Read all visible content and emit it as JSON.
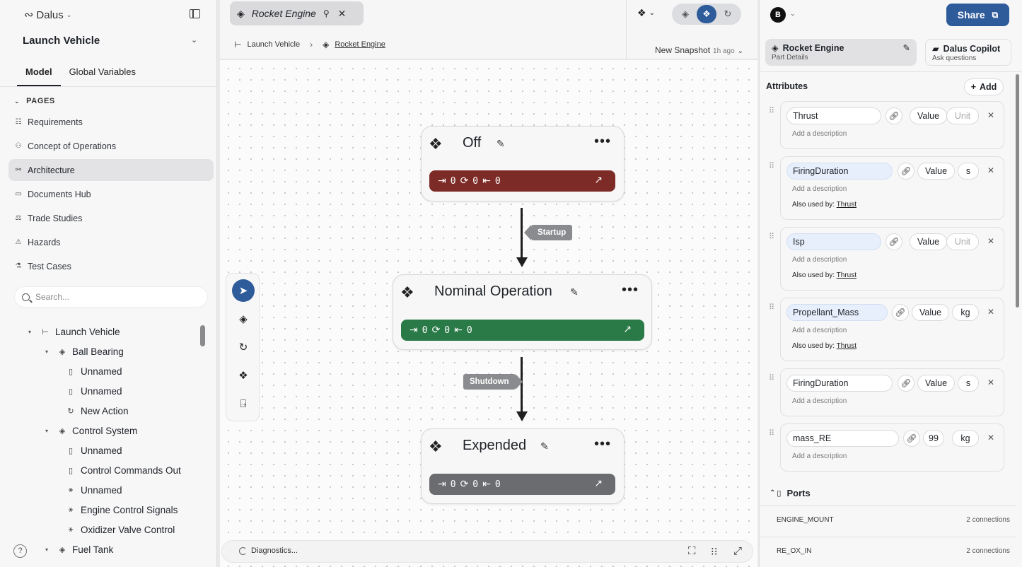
{
  "sidebar": {
    "logo": "Dalus",
    "project": "Launch Vehicle",
    "tabs": [
      "Model",
      "Global Variables"
    ],
    "pages_heading": "PAGES",
    "pages": [
      "Requirements",
      "Concept of Operations",
      "Architecture",
      "Documents Hub",
      "Trade Studies",
      "Hazards",
      "Test Cases"
    ],
    "active_page": "Architecture",
    "search_placeholder": "Search...",
    "tree": [
      {
        "label": "Launch Vehicle",
        "icon": "hierarchy-icon"
      },
      {
        "label": "Ball Bearing",
        "icon": "cube-icon"
      },
      {
        "label": "Unnamed",
        "icon": "port-icon"
      },
      {
        "label": "Unnamed",
        "icon": "port-icon"
      },
      {
        "label": "New Action",
        "icon": "action-icon"
      },
      {
        "label": "Control System",
        "icon": "cube-icon"
      },
      {
        "label": "Unnamed",
        "icon": "port-icon"
      },
      {
        "label": "Control Commands Out",
        "icon": "port-icon"
      },
      {
        "label": "Unnamed",
        "icon": "interface-icon"
      },
      {
        "label": "Engine Control Signals",
        "icon": "interface-icon"
      },
      {
        "label": "Oxidizer Valve Control",
        "icon": "interface-icon"
      },
      {
        "label": "Fuel Tank",
        "icon": "cube-icon"
      }
    ],
    "help": "?"
  },
  "center": {
    "doc_tab": "Rocket Engine",
    "breadcrumb": [
      "Launch Vehicle",
      "Rocket Engine"
    ],
    "snapshot": "New Snapshot",
    "snapshot_time": "1h ago",
    "states": [
      {
        "name": "Off",
        "entry": "0",
        "do": "0",
        "exit": "0",
        "color": "#7d2b26"
      },
      {
        "name": "Nominal Operation",
        "entry": "0",
        "do": "0",
        "exit": "0",
        "color": "#2a7a47"
      },
      {
        "name": "Expended",
        "entry": "0",
        "do": "0",
        "exit": "0",
        "color": "#6b6c70"
      }
    ],
    "transitions": [
      "Startup",
      "Shutdown"
    ],
    "diagnostics": "Diagnostics..."
  },
  "right": {
    "avatar": "B",
    "share": "Share",
    "tabs": [
      {
        "title": "Rocket Engine",
        "subtitle": "Part Details"
      },
      {
        "title": "Dalus Copilot",
        "subtitle": "Ask questions"
      }
    ],
    "attributes_heading": "Attributes",
    "add_label": "Add",
    "desc_placeholder": "Add a description",
    "also_used_label": "Also used by:",
    "attributes": [
      {
        "name": "Thrust",
        "value": "Value",
        "unit": "Unit",
        "used_by": ""
      },
      {
        "name": "FiringDuration",
        "value": "Value",
        "unit": "s",
        "used_by": "Thrust"
      },
      {
        "name": "Isp",
        "value": "Value",
        "unit": "Unit",
        "used_by": "Thrust"
      },
      {
        "name": "Propellant_Mass",
        "value": "Value",
        "unit": "kg",
        "used_by": "Thrust"
      },
      {
        "name": "FiringDuration",
        "value": "Value",
        "unit": "s",
        "used_by": ""
      },
      {
        "name": "mass_RE",
        "value": "99",
        "unit": "kg",
        "used_by": ""
      }
    ],
    "ports_heading": "Ports",
    "ports": [
      {
        "name": "ENGINE_MOUNT",
        "connections": "2 connections"
      },
      {
        "name": "RE_OX_IN",
        "connections": "2 connections"
      }
    ]
  },
  "colors": {
    "accent": "#2e5b9a",
    "off": "#7d2b26",
    "nominal": "#2a7a47",
    "expended": "#6b6c70"
  }
}
